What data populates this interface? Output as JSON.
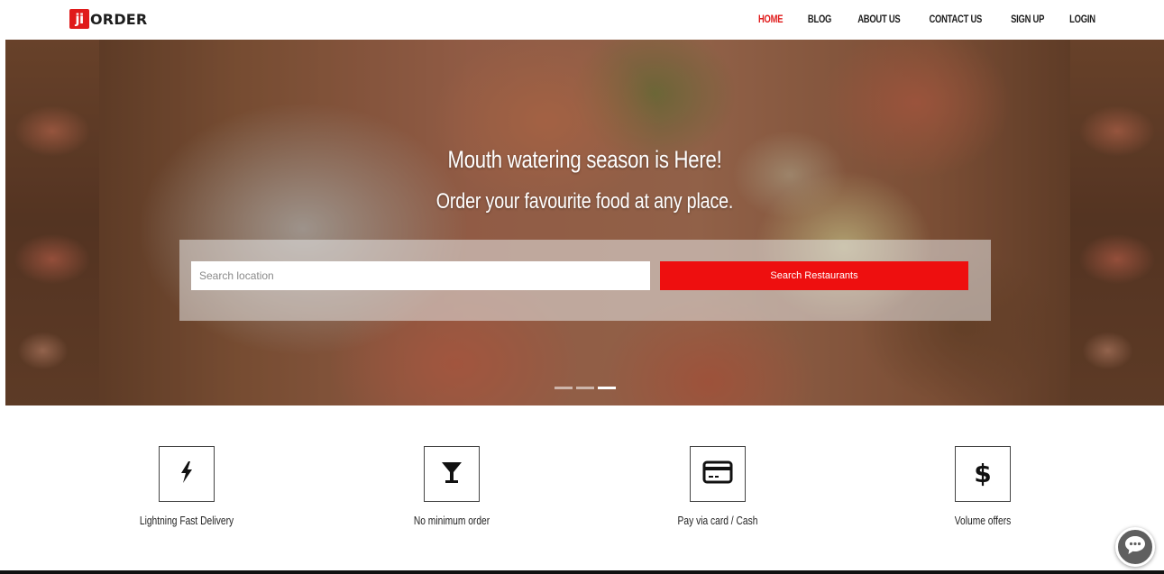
{
  "header": {
    "logo_mark": "ji",
    "logo_text": "ORDER",
    "nav": [
      {
        "label": "HOME",
        "active": true
      },
      {
        "label": "BLOG",
        "active": false
      },
      {
        "label": "ABOUT US",
        "active": false
      },
      {
        "label": "CONTACT US",
        "active": false
      },
      {
        "label": "SIGN UP",
        "active": false
      },
      {
        "label": "LOGIN",
        "active": false
      }
    ]
  },
  "hero": {
    "title": "Mouth watering season is Here!",
    "subtitle": "Order your favourite food at any place.",
    "search": {
      "placeholder": "Search location",
      "value": "",
      "button_label": "Search Restaurants"
    },
    "carousel": {
      "slide_count": 3,
      "active_index": 2
    }
  },
  "features": [
    {
      "label": "Lightning Fast Delivery",
      "icon": "lightning-icon"
    },
    {
      "label": "No minimum order",
      "icon": "cocktail-glass-icon"
    },
    {
      "label": "Pay via card / Cash",
      "icon": "credit-card-icon"
    },
    {
      "label": "Volume offers",
      "icon": "dollar-icon",
      "glyph": "$"
    }
  ],
  "colors": {
    "brand_red": "#e01b1b",
    "search_button": "#ee0f0f",
    "text_dark": "#1b1b1b"
  }
}
